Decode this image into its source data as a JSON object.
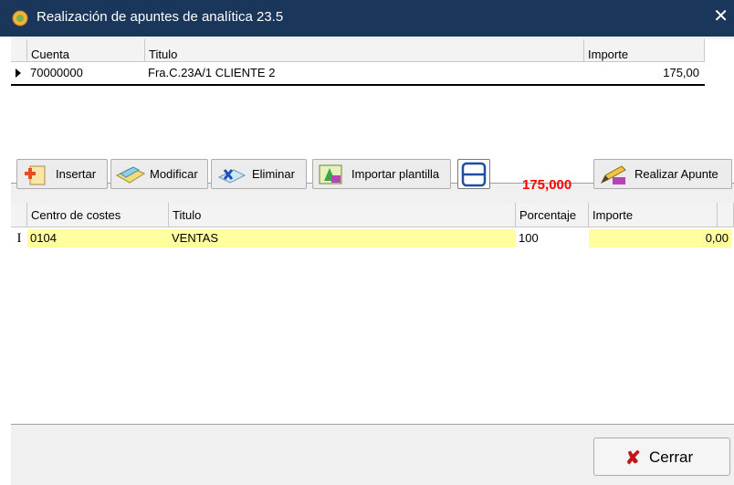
{
  "window": {
    "title": "Realización de apuntes de analítica  23.5",
    "close_glyph": "✕"
  },
  "grid_top": {
    "columns": [
      "Cuenta",
      "Titulo",
      "Importe"
    ],
    "rows": [
      {
        "cuenta": "70000000",
        "titulo": "Fra.C.23A/1 CLIENTE 2",
        "importe": "175,00"
      }
    ]
  },
  "toolbar": {
    "insert_label": "Insertar",
    "modify_label": "Modificar",
    "delete_label": "Eliminar",
    "import_label": "Importar plantilla",
    "total_value": "175,000",
    "apply_label": "Realizar Apunte"
  },
  "grid_bottom": {
    "columns": [
      "Centro de costes",
      "Titulo",
      "Porcentaje",
      "Importe"
    ],
    "rows": [
      {
        "centro": "0104",
        "titulo": "VENTAS",
        "porcentaje": "100",
        "importe": "0,00"
      }
    ]
  },
  "footer": {
    "close_label": "Cerrar",
    "close_icon_glyph": "✘"
  },
  "colors": {
    "titlebar": "#1b365b",
    "highlight_yellow": "#ffffa0",
    "total_red": "#ff0000"
  }
}
